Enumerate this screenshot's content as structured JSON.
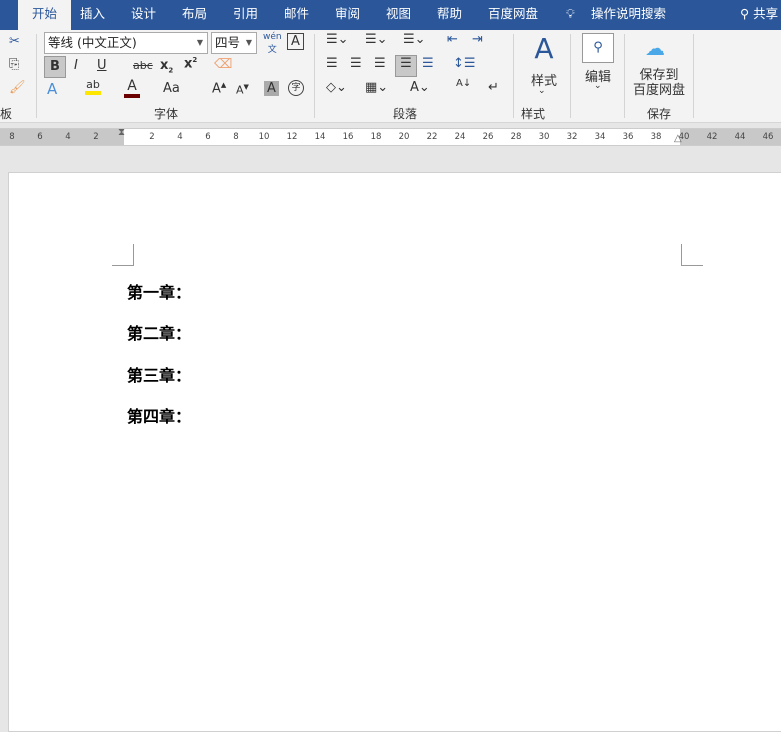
{
  "tabs": [
    "开始",
    "插入",
    "设计",
    "布局",
    "引用",
    "邮件",
    "审阅",
    "视图",
    "帮助",
    "百度网盘"
  ],
  "search_label": "操作说明搜索",
  "share_label": "共享",
  "font": {
    "name": "等线 (中文正文)",
    "size": "四号",
    "group_label": "字体"
  },
  "clipboard": {
    "group_label": "板"
  },
  "paragraph": {
    "group_label": "段落"
  },
  "styles": {
    "button_label": "样式",
    "group_label": "样式"
  },
  "editing": {
    "button_label": "编辑"
  },
  "save": {
    "button_line1": "保存到",
    "button_line2": "百度网盘",
    "group_label": "保存"
  },
  "ruler": {
    "left": [
      "8",
      "6",
      "4",
      "2"
    ],
    "right": [
      "2",
      "4",
      "6",
      "8",
      "10",
      "12",
      "14",
      "16",
      "18",
      "20",
      "22",
      "24",
      "26",
      "28",
      "30",
      "32",
      "34",
      "36",
      "38",
      "40",
      "42",
      "44",
      "46"
    ]
  },
  "document": {
    "headings": [
      "第一章：",
      "第二章：",
      "第三章：",
      "第四章："
    ]
  },
  "colors": {
    "accent": "#2b579a",
    "highlight": "#ffe600",
    "font_color": "#6b0000"
  }
}
